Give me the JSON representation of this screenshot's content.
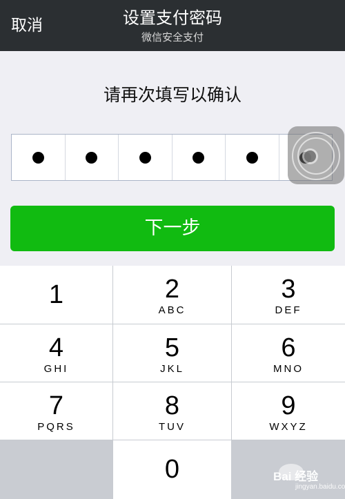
{
  "nav": {
    "cancel_label": "取消",
    "title": "设置支付密码",
    "subtitle": "微信安全支付"
  },
  "prompt": "请再次填写以确认",
  "pin": {
    "length": 6,
    "filled": 6
  },
  "next_button_label": "下一步",
  "keys": [
    {
      "num": "1",
      "letters": ""
    },
    {
      "num": "2",
      "letters": "ABC"
    },
    {
      "num": "3",
      "letters": "DEF"
    },
    {
      "num": "4",
      "letters": "GHI"
    },
    {
      "num": "5",
      "letters": "JKL"
    },
    {
      "num": "6",
      "letters": "MNO"
    },
    {
      "num": "7",
      "letters": "PQRS"
    },
    {
      "num": "8",
      "letters": "TUV"
    },
    {
      "num": "9",
      "letters": "WXYZ"
    },
    {
      "num": "",
      "letters": ""
    },
    {
      "num": "0",
      "letters": ""
    },
    {
      "num": "",
      "letters": ""
    }
  ],
  "watermark": {
    "text": "Bai 经验",
    "sub": "jingyan.baidu.com"
  },
  "colors": {
    "navbar": "#2b2f32",
    "background": "#efeff4",
    "accent_green": "#11bb11",
    "keypad_divider": "#c7cbd1"
  },
  "icons": [
    "assistive-touch-icon",
    "baidu-paw-icon"
  ]
}
